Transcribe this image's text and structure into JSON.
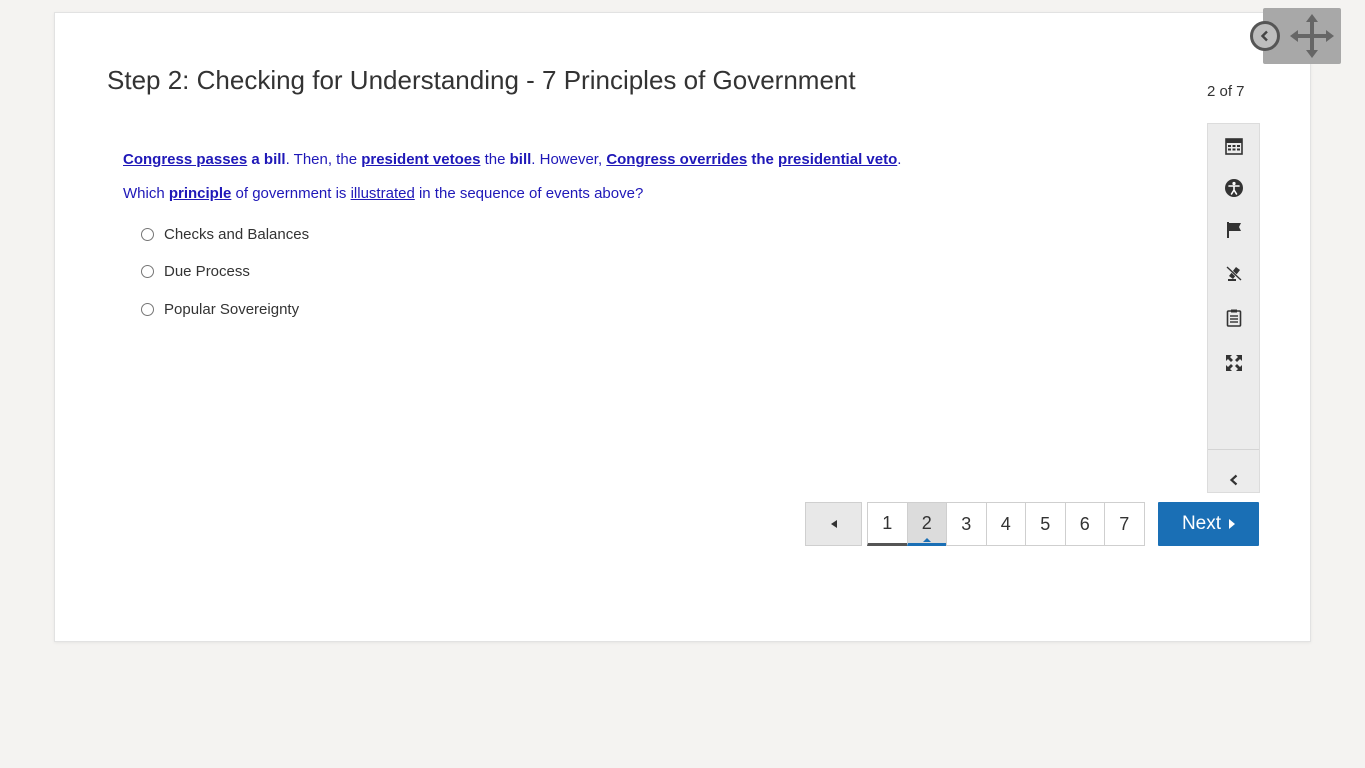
{
  "header": {
    "title": "Step 2: Checking for Understanding - 7 Principles of Government",
    "page_count": "2 of 7"
  },
  "question": {
    "stem_parts": {
      "p1": "Congress passes",
      "p2": "a bill",
      "p3": ". Then, the ",
      "p4": "president vetoes",
      "p5": " the ",
      "p6": "bill",
      "p7": ". However, ",
      "p8": "Congress overrides",
      "p9": " the ",
      "p10": "presidential veto",
      "p11": "."
    },
    "prompt_parts": {
      "p1": "Which ",
      "p2": "principle",
      "p3": " of government is ",
      "p4": "illustrated",
      "p5": " in the sequence of events above?"
    },
    "choices": [
      {
        "label": "Checks and Balances",
        "selected": false
      },
      {
        "label": "Due Process",
        "selected": false
      },
      {
        "label": "Popular Sovereignty",
        "selected": false
      }
    ]
  },
  "toolbar": {
    "tools": [
      "calendar-icon",
      "accessibility-icon",
      "flag-icon",
      "no-highlight-icon",
      "notepad-icon",
      "fullscreen-icon"
    ],
    "collapse": "chevron-left-icon"
  },
  "pagination": {
    "prev_icon": "triangle-left-icon",
    "pages": [
      "1",
      "2",
      "3",
      "4",
      "5",
      "6",
      "7"
    ],
    "current_page": "2",
    "next_label": "Next"
  },
  "colors": {
    "question_text": "#1f18b8",
    "accent": "#1a6fb5",
    "background": "#f4f3f1"
  }
}
